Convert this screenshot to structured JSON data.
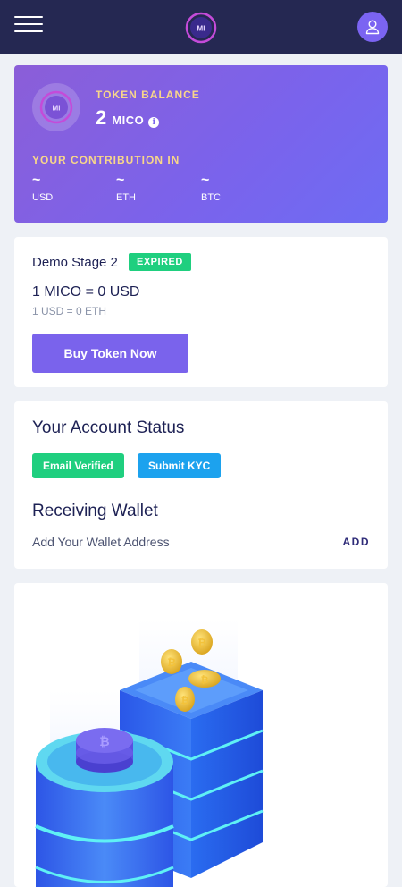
{
  "header": {
    "menu_icon": "hamburger-menu-icon",
    "logo_text": "MI",
    "user_icon": "user-icon"
  },
  "balance": {
    "label": "TOKEN BALANCE",
    "amount": "2",
    "unit": "MICO",
    "info_icon": "i",
    "contribution_label": "YOUR CONTRIBUTION IN",
    "contributions": [
      {
        "value": "~",
        "currency": "USD"
      },
      {
        "value": "~",
        "currency": "ETH"
      },
      {
        "value": "~",
        "currency": "BTC"
      }
    ]
  },
  "stage": {
    "title": "Demo Stage 2",
    "status": "EXPIRED",
    "rate": "1 MICO = 0 USD",
    "rate_sub": "1 USD = 0 ETH",
    "buy_label": "Buy Token Now"
  },
  "account": {
    "title": "Your Account Status",
    "email_label": "Email Verified",
    "kyc_label": "Submit KYC",
    "wallet_title": "Receiving Wallet",
    "wallet_text": "Add Your Wallet Address",
    "add_label": "ADD"
  },
  "colors": {
    "header_bg": "#252852",
    "accent": "#7a63ec",
    "success": "#1fcf7f",
    "info": "#1ca2ee",
    "gold_label": "#f8d68a"
  }
}
